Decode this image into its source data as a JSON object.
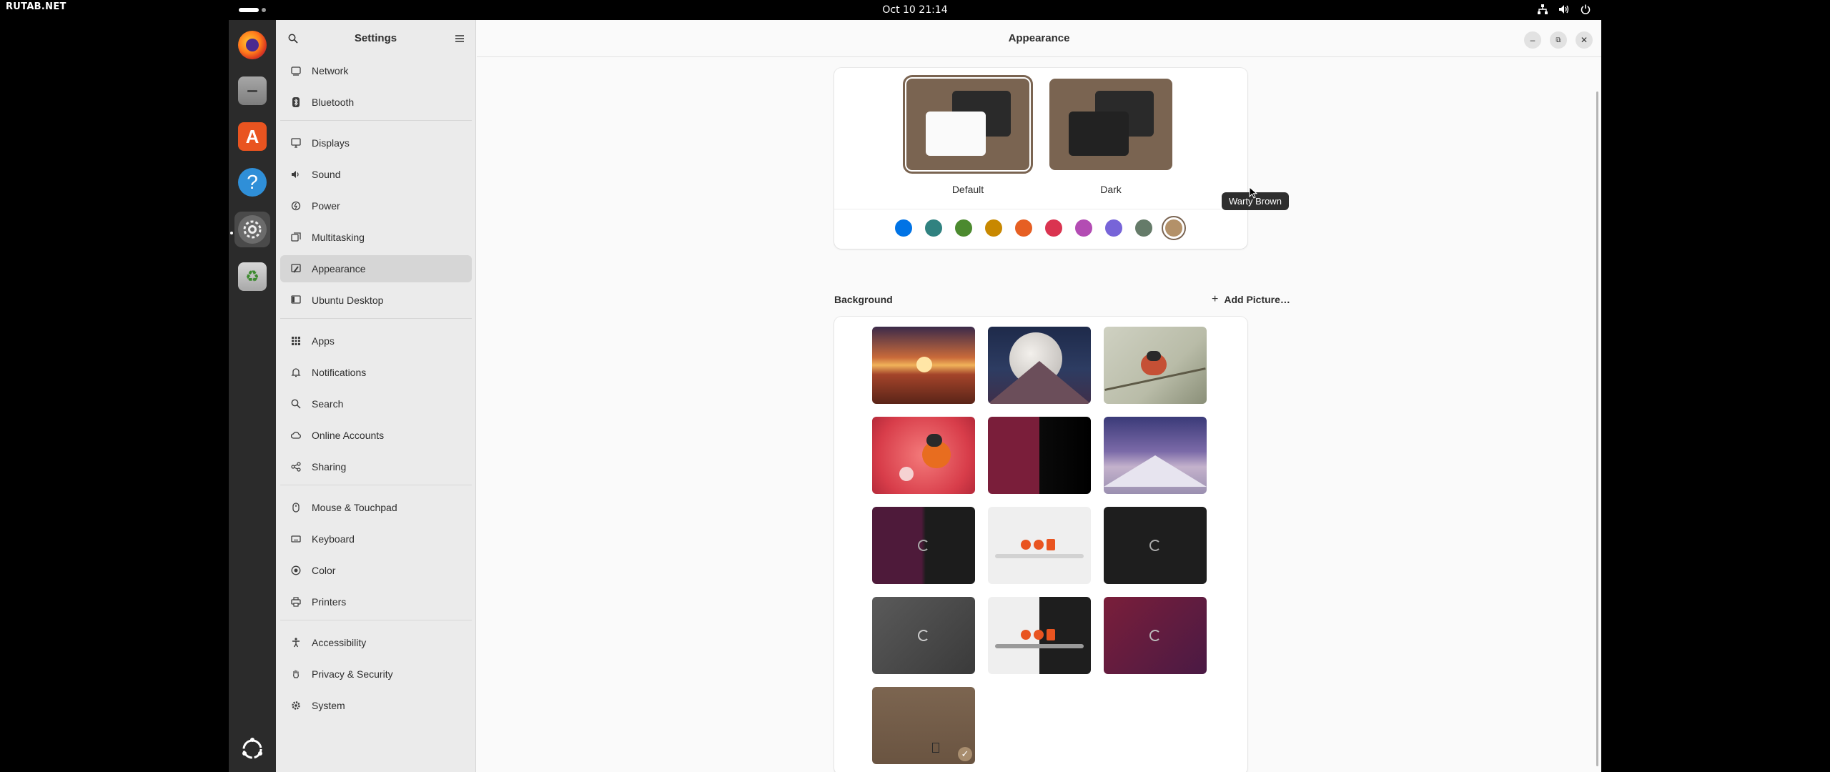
{
  "watermark": "RUTAB.NET",
  "topbar": {
    "clock": "Oct 10  21:14"
  },
  "dock": {
    "apps": [
      {
        "name": "firefox",
        "icon": "firefox-icon",
        "color": "#e66000"
      },
      {
        "name": "files",
        "icon": "files-icon",
        "color": "#8b8b8b"
      },
      {
        "name": "app-center",
        "icon": "app-center-icon",
        "color": "#e95420"
      },
      {
        "name": "help",
        "icon": "help-icon",
        "color": "#2f8fd8"
      },
      {
        "name": "settings",
        "icon": "settings-icon",
        "color": "#6b6b6b"
      },
      {
        "name": "trash",
        "icon": "trash-icon",
        "color": "#5e9c4a"
      }
    ]
  },
  "sidebar": {
    "title": "Settings",
    "items": [
      {
        "label": "Network",
        "icon": "network-icon"
      },
      {
        "label": "Bluetooth",
        "icon": "bluetooth-icon"
      },
      {
        "label": "Displays",
        "icon": "display-icon"
      },
      {
        "label": "Sound",
        "icon": "sound-icon"
      },
      {
        "label": "Power",
        "icon": "power-icon"
      },
      {
        "label": "Multitasking",
        "icon": "multitasking-icon"
      },
      {
        "label": "Appearance",
        "icon": "appearance-icon",
        "selected": true
      },
      {
        "label": "Ubuntu Desktop",
        "icon": "ubuntu-desktop-icon"
      },
      {
        "label": "Apps",
        "icon": "apps-icon"
      },
      {
        "label": "Notifications",
        "icon": "bell-icon"
      },
      {
        "label": "Search",
        "icon": "search-icon"
      },
      {
        "label": "Online Accounts",
        "icon": "cloud-icon"
      },
      {
        "label": "Sharing",
        "icon": "share-icon"
      },
      {
        "label": "Mouse & Touchpad",
        "icon": "mouse-icon"
      },
      {
        "label": "Keyboard",
        "icon": "keyboard-icon"
      },
      {
        "label": "Color",
        "icon": "color-icon"
      },
      {
        "label": "Printers",
        "icon": "printer-icon"
      },
      {
        "label": "Accessibility",
        "icon": "accessibility-icon"
      },
      {
        "label": "Privacy & Security",
        "icon": "hand-icon"
      },
      {
        "label": "System",
        "icon": "gear-icon"
      }
    ]
  },
  "content": {
    "title": "Appearance",
    "style": {
      "options": [
        {
          "label": "Default",
          "selected": true
        },
        {
          "label": "Dark",
          "selected": false
        }
      ]
    },
    "accent_colors": [
      {
        "color": "#0073e5"
      },
      {
        "color": "#308280"
      },
      {
        "color": "#4c8a2f"
      },
      {
        "color": "#c88800"
      },
      {
        "color": "#e65f23"
      },
      {
        "color": "#da3450"
      },
      {
        "color": "#b34cb3"
      },
      {
        "color": "#7764d8"
      },
      {
        "color": "#657b69"
      },
      {
        "color": "#b39169",
        "selected": true
      }
    ],
    "tooltip": "Warty Brown",
    "background": {
      "title": "Background",
      "add_picture": "Add Picture…",
      "thumbnails": [
        {
          "name": "desert-sunset"
        },
        {
          "name": "mountain-moon"
        },
        {
          "name": "bird-branch"
        },
        {
          "name": "orange-bird-pink"
        },
        {
          "name": "split-red-black"
        },
        {
          "name": "snowy-mountains"
        },
        {
          "name": "purple-dark-ubuntu"
        },
        {
          "name": "light-ubuntu-logos"
        },
        {
          "name": "dark-ubuntu"
        },
        {
          "name": "grey-ubuntu"
        },
        {
          "name": "light-dark-ubuntu-logos"
        },
        {
          "name": "purple-ubuntu"
        },
        {
          "name": "warty-brown",
          "selected": true
        }
      ]
    }
  }
}
